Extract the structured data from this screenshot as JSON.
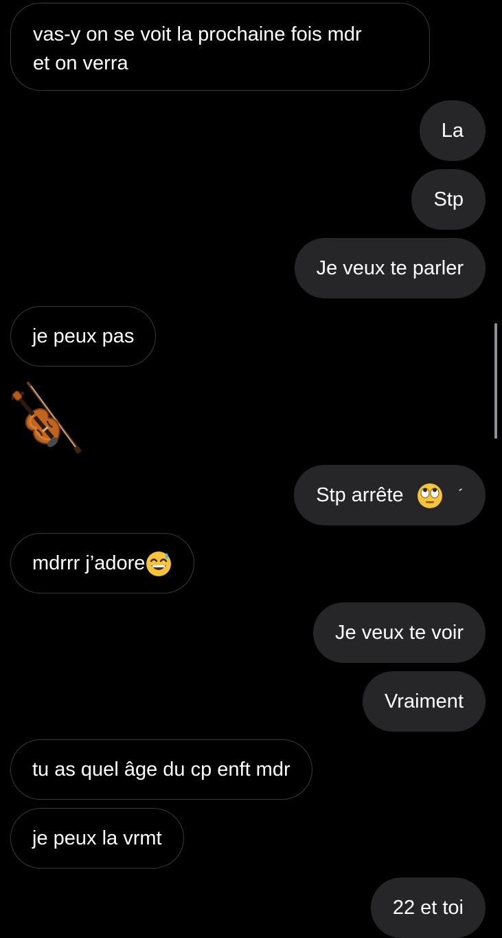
{
  "conversation": {
    "messages": [
      {
        "direction": "incoming",
        "text_line1": "vas-y on se voit la prochaine fois mdr",
        "text_line2": "et on verra"
      },
      {
        "direction": "outgoing",
        "text": "La"
      },
      {
        "direction": "outgoing",
        "text": "Stp"
      },
      {
        "direction": "outgoing",
        "text": "Je veux te parler"
      },
      {
        "direction": "incoming",
        "text": "je peux pas"
      },
      {
        "direction": "incoming",
        "sticker": "violin-emoji"
      },
      {
        "direction": "outgoing",
        "text": "Stp arrête",
        "emoji": "eye-roll-emoji",
        "trailing": "´"
      },
      {
        "direction": "incoming",
        "text": "mdrrr j’adore",
        "emoji": "sweat-smile-emoji"
      },
      {
        "direction": "outgoing",
        "text": "Je veux te voir"
      },
      {
        "direction": "outgoing",
        "text": "Vraiment"
      },
      {
        "direction": "incoming",
        "text": "tu as quel âge du cp enft mdr"
      },
      {
        "direction": "incoming",
        "text": "je peux la vrmt"
      },
      {
        "direction": "outgoing",
        "text": "22 et toi"
      }
    ]
  },
  "colors": {
    "background": "#000000",
    "outgoing_bubble": "#262628",
    "incoming_border": "#3a3a3c",
    "text": "#ffffff"
  }
}
